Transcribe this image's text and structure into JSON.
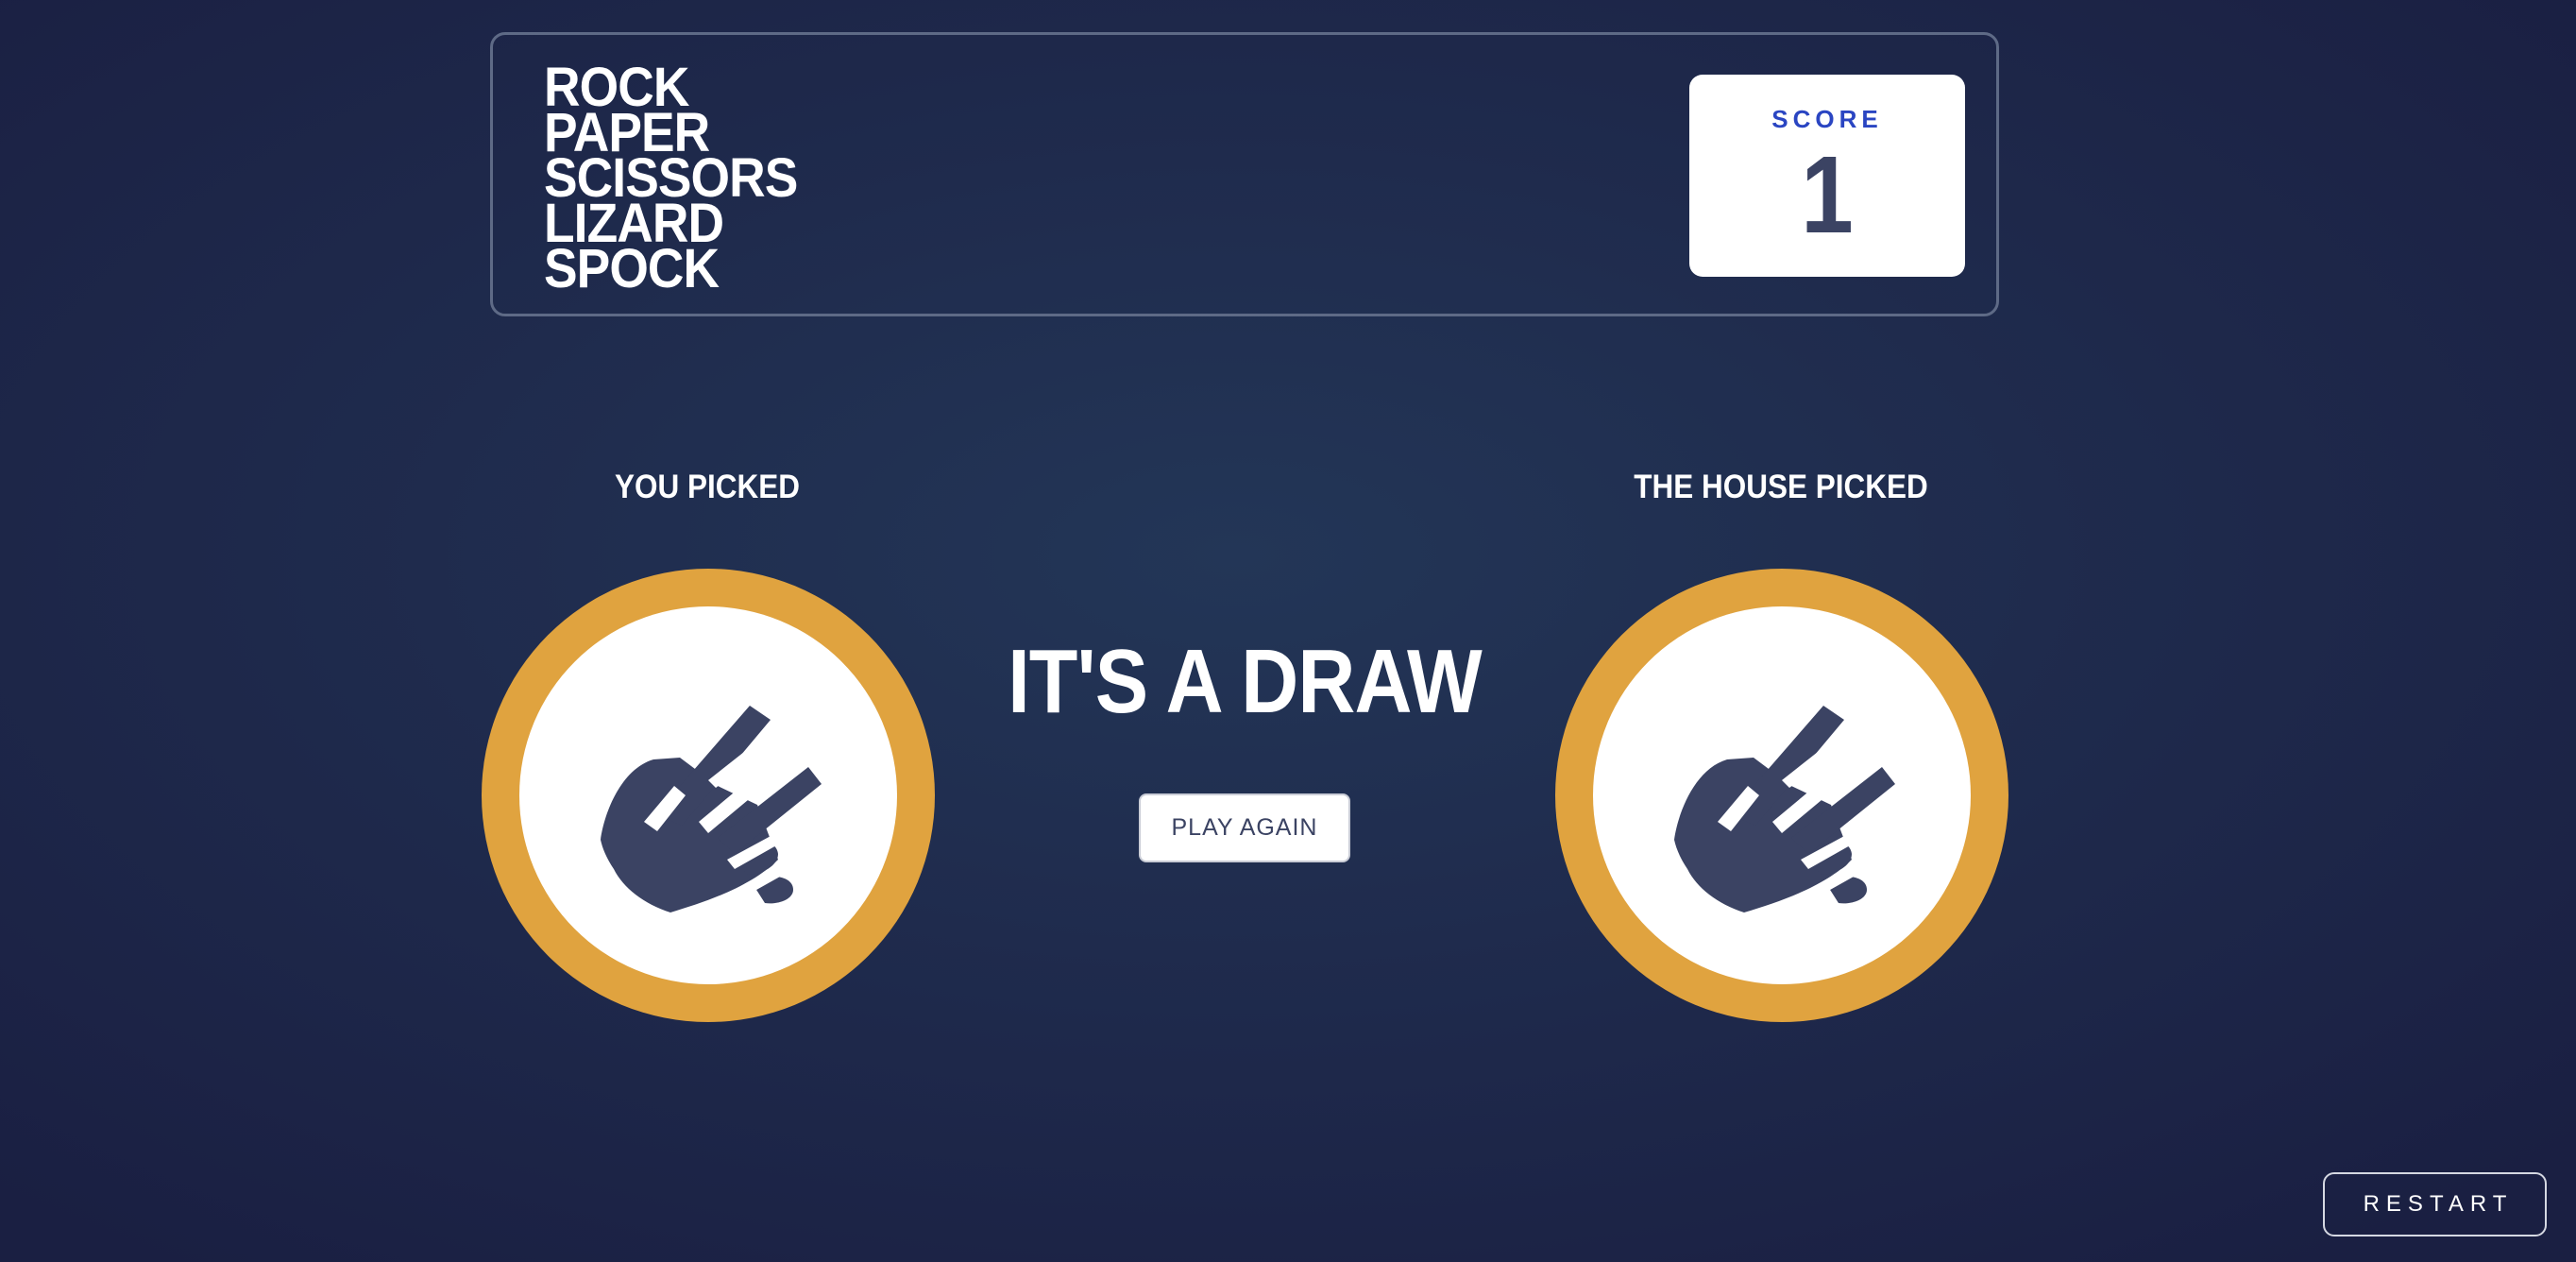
{
  "header": {
    "logo_lines": [
      "ROCK",
      "PAPER",
      "SCISSORS",
      "LIZARD",
      "SPOCK"
    ],
    "score_label": "SCORE",
    "score_value": "1"
  },
  "game": {
    "you_picked_label": "YOU PICKED",
    "house_picked_label": "THE HOUSE PICKED",
    "player_choice": "lizard-icon",
    "house_choice": "lizard-icon",
    "result_text": "IT'S A DRAW",
    "play_again_label": "PLAY AGAIN"
  },
  "footer": {
    "restart_label": "RESTART"
  },
  "colors": {
    "token_ring": "#e0a33f",
    "icon": "#3b4363",
    "score_label": "#2a45c2",
    "background": "#1f2b4d"
  }
}
